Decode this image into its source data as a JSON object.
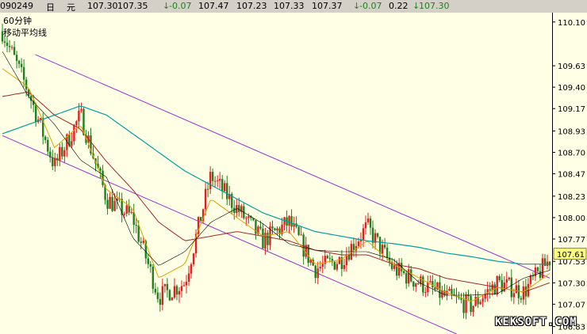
{
  "header": {
    "code": "090249",
    "period": "日",
    "unit": "元",
    "v1": "107.30",
    "v2": "107.35",
    "v3_arrow": "↓",
    "v3": "-0.07",
    "v4": "107.47",
    "v5": "107.23",
    "v6": "107.33",
    "v7": "107.37",
    "v8_arrow": "↓",
    "v8": "-0.07",
    "v9": "0.22",
    "v10_arrow": "↓",
    "v10": "107.30"
  },
  "labels": {
    "interval": "60分钟",
    "indicator": "移动平均线",
    "watermark": "KEKSOFT.COM"
  },
  "colors": {
    "background": "#ffffe6",
    "up": "#e02020",
    "down": "#208020",
    "ma_short": "#e0a000",
    "ma_mid": "#a02828",
    "ma_long": "#00a0a0",
    "ma_extra": "#000000",
    "channel": "#9932cc",
    "last_price_box": "#ffff80"
  },
  "chart_data": {
    "type": "candlestick",
    "ylim": [
      106.75,
      110.2
    ],
    "y_ticks": [
      "110.10",
      "109.63",
      "109.40",
      "109.17",
      "108.93",
      "108.70",
      "108.47",
      "108.23",
      "108.00",
      "107.77",
      "107.53",
      "107.30",
      "107.07",
      "106.83"
    ],
    "last_price": "107.61",
    "trend_anchors": [
      110.0,
      109.35,
      108.55,
      109.1,
      108.2,
      108.0,
      107.15,
      107.3,
      108.45,
      108.1,
      107.75,
      107.95,
      107.45,
      107.55,
      107.9,
      107.45,
      107.3,
      107.15,
      107.05,
      107.3,
      107.2,
      107.55
    ],
    "ma_short_anchors": [
      109.6,
      109.4,
      108.75,
      109.0,
      108.3,
      108.1,
      107.35,
      107.5,
      108.2,
      108.0,
      107.8,
      107.85,
      107.5,
      107.55,
      107.75,
      107.5,
      107.35,
      107.2,
      107.1,
      107.25,
      107.2,
      107.4
    ],
    "ma_mid_anchors": [
      109.3,
      109.35,
      109.1,
      108.95,
      108.6,
      108.3,
      107.95,
      107.75,
      107.8,
      107.85,
      107.8,
      107.75,
      107.65,
      107.6,
      107.6,
      107.5,
      107.45,
      107.35,
      107.3,
      107.25,
      107.2,
      107.3
    ],
    "ma_long_anchors": [
      108.9,
      109.0,
      109.1,
      109.2,
      109.1,
      108.9,
      108.7,
      108.5,
      108.35,
      108.2,
      108.05,
      107.95,
      107.85,
      107.8,
      107.75,
      107.72,
      107.68,
      107.62,
      107.58,
      107.53,
      107.5,
      107.5
    ],
    "channel_upper": [
      {
        "i": 0.06,
        "v": 109.75
      },
      {
        "i": 1.0,
        "v": 107.35
      }
    ],
    "channel_lower": [
      {
        "i": 0.0,
        "v": 108.88
      },
      {
        "i": 0.83,
        "v": 106.75
      }
    ]
  }
}
